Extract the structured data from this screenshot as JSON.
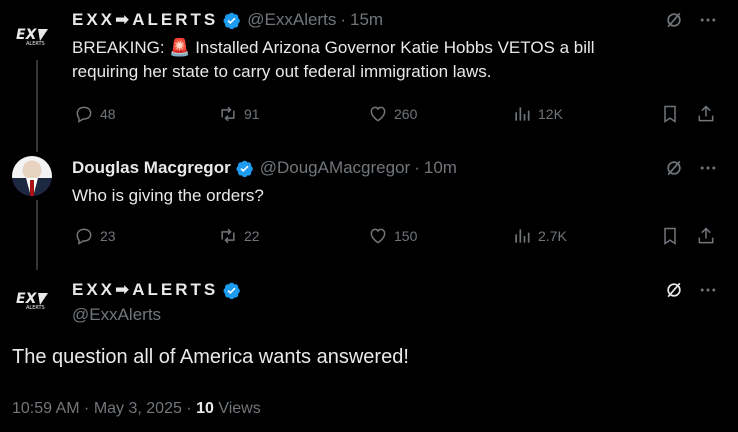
{
  "tweets": [
    {
      "author_name": "EXX➡ALERTS",
      "handle": "@ExxAlerts",
      "separator": "·",
      "time": "15m",
      "body_line1": "BREAKING: 🚨 Installed Arizona Governor Katie Hobbs VETOS a bill",
      "body_line2": "requiring her state to carry out federal immigration laws.",
      "replies": "48",
      "reposts": "91",
      "likes": "260",
      "views": "12K"
    },
    {
      "author_name": "Douglas Macgregor",
      "handle": "@DougAMacgregor",
      "separator": "·",
      "time": "10m",
      "body_line1": "Who is giving the orders?",
      "replies": "23",
      "reposts": "22",
      "likes": "150",
      "views": "2.7K"
    }
  ],
  "main_tweet": {
    "author_name": "EXX➡ALERTS",
    "handle": "@ExxAlerts",
    "body": "The question all of America wants answered!",
    "timestamp": "10:59 AM · May 3, 2025 · ",
    "view_count": "10",
    "views_label": "Views"
  },
  "colors": {
    "background": "#000000",
    "text": "#e7e9ea",
    "muted": "#71767b",
    "verified": "#1d9bf0"
  },
  "icons": [
    "exx-logo-icon",
    "verified-icon",
    "grok-icon",
    "more-icon",
    "reply-icon",
    "repost-icon",
    "like-icon",
    "views-icon",
    "bookmark-icon",
    "share-icon"
  ]
}
